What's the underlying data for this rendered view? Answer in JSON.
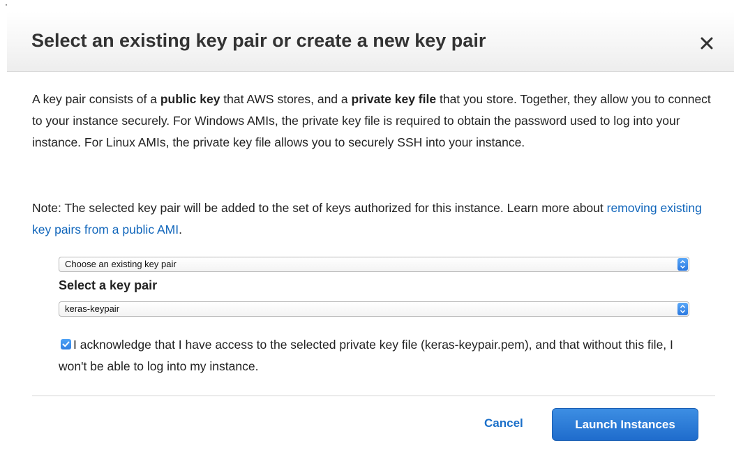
{
  "dialog": {
    "title": "Select an existing key pair or create a new key pair",
    "close_icon": "close-icon"
  },
  "intro": {
    "t1": "A key pair consists of a ",
    "b1": "public key",
    "t2": " that AWS stores, and a ",
    "b2": "private key file",
    "t3": " that you store. Together, they allow you to connect to your instance securely. For Windows AMIs, the private key file is required to obtain the password used to log into your instance. For Linux AMIs, the private key file allows you to securely SSH into your instance."
  },
  "note": {
    "text": "Note: The selected key pair will be added to the set of keys authorized for this instance. Learn more about ",
    "link": "removing existing key pairs from a public AMI",
    "after": "."
  },
  "key_option_select": {
    "value": "Choose an existing key pair",
    "icon": "select-arrows-icon"
  },
  "key_pair": {
    "label": "Select a key pair",
    "value": "keras-keypair",
    "icon": "select-arrows-icon"
  },
  "acknowledge": {
    "checked": true,
    "text": "I acknowledge that I have access to the selected private key file (keras-keypair.pem), and that without this file, I won't be able to log into my instance."
  },
  "footer": {
    "cancel_label": "Cancel",
    "launch_label": "Launch Instances"
  },
  "colors": {
    "link": "#1166bb",
    "primary_button": "#2a78d6",
    "header_bg": "#f3f3f3",
    "checkbox": "#3b8ced"
  }
}
